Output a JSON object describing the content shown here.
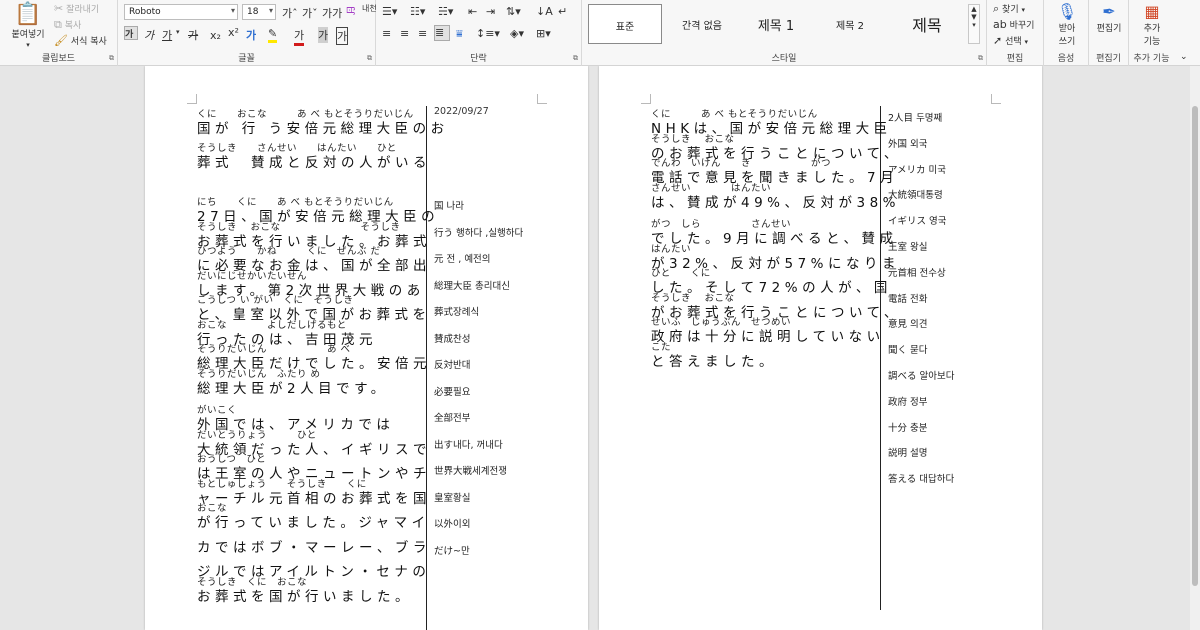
{
  "ribbon": {
    "clipboard": {
      "label": "클립보드",
      "paste": "붙여넣기",
      "cut": "잘라내기",
      "copy": "복사",
      "format_painter": "서식 복사"
    },
    "font": {
      "label": "글꼴",
      "font_name": "Roboto",
      "font_size": "18"
    },
    "paragraph": {
      "label": "단락"
    },
    "styles": {
      "label": "스타일",
      "items": [
        "표준",
        "간격 없음",
        "제목 1",
        "제목 2",
        "제목"
      ]
    },
    "editing": {
      "label": "편집",
      "find": "찾기",
      "replace": "바꾸기",
      "select": "선택"
    },
    "voice": {
      "label": "음성",
      "dictate_line1": "받아",
      "dictate_line2": "쓰기"
    },
    "editor": {
      "label": "편집기",
      "button": "편집기"
    },
    "addins": {
      "label": "추가 기능",
      "button_line1": "추가",
      "button_line2": "기능"
    }
  },
  "page1": {
    "date": "2022/09/27",
    "title_lines": [
      {
        "gloss": "くに　　おこな　　　あ べ もとそうりだいじん",
        "text": "国が 行 う安倍元総理大臣のお"
      },
      {
        "gloss": "そうしき　　さんせい　　はんたい　　ひと",
        "text": "葬式　賛成と反対の人がいる"
      }
    ],
    "body_lines": [
      {
        "gloss": "にち　　くに　　あ べ もとそうりだいじん",
        "text": "27日、国が安倍元総理大臣の"
      },
      {
        "gloss": "そうしき　 おこな　　　　　　　　そうしき",
        "text": "お葬式を行いました。お葬式"
      },
      {
        "gloss": "ひつよう　　かね　　　くに　ぜんぶ だ",
        "text": "に必要なお金は、国が全部出"
      },
      {
        "gloss": "だいにじせかいたいせん",
        "text": "します。第2次世界大戦のあ"
      },
      {
        "gloss": "こうしつ い がい　くに　そうしき",
        "text": "と、皇室以外で国がお葬式を"
      },
      {
        "gloss": "おこな　　　　よしだしげるもと",
        "text": "行ったのは、吉田茂元"
      },
      {
        "gloss": "そうりだいじん　　　　　　あ べ",
        "text": "総理大臣だけでした。安倍元"
      },
      {
        "gloss": "そうりだいじん　ふたり め",
        "text": "総理大臣が2人目です。"
      },
      {
        "gloss": "がいこく",
        "text": "外国では、アメリカでは"
      },
      {
        "gloss": "だいとうりょう　　　ひと",
        "text": "大統領だった人、イギリスで"
      },
      {
        "gloss": "おうしつ　ひと",
        "text": "は王室の人やニュートンやチ"
      },
      {
        "gloss": "もとしゅしょう　　そうしき　　くに",
        "text": "ャーチル元首相のお葬式を国"
      },
      {
        "gloss": "おこな",
        "text": "が行っていました。ジャマイ"
      },
      {
        "gloss": "",
        "text": "カではボブ・マーレー、ブラ"
      },
      {
        "gloss": "",
        "text": "ジルではアイルトン・セナの"
      },
      {
        "gloss": "そうしき　くに　おこな",
        "text": "お葬式を国が行いました。"
      }
    ],
    "vocab": [
      "国 나라",
      "行う 행하다 ,실행하다",
      "元 전 , 예전의",
      "総理大臣 총리대신",
      "葬式장례식",
      "賛成찬성",
      "反対반대",
      "必要필요",
      "全部전부",
      "出す내다, 꺼내다",
      "世界大戦세계전쟁",
      "皇室황실",
      "以外이외",
      "だけ~만"
    ]
  },
  "page2": {
    "body_lines": [
      {
        "gloss": "くに　　　あ べ もとそうりだいじん",
        "text": "NHKは、国が安倍元総理大臣"
      },
      {
        "gloss": "そうしき　 おこな",
        "text": "のお葬式を行うことについて、"
      },
      {
        "gloss": "でんわ　いけん　　き　　　　　　がつ",
        "text": "電話で意見を聞きました。7月"
      },
      {
        "gloss": "さんせい　　　　はんたい",
        "text": "は、賛成が49%、反対が38%"
      },
      {
        "gloss": "がつ　しら　　　　　さんせい",
        "text": "でした。9月に調べると、賛成"
      },
      {
        "gloss": "はんたい",
        "text": "が32%、反対が57%になりま"
      },
      {
        "gloss": "ひと　　くに",
        "text": "した。そして72%の人が、国"
      },
      {
        "gloss": "そうしき　 おこな",
        "text": "がお葬式を行うことについて、"
      },
      {
        "gloss": "せいふ　じゅうぶん　せつめい",
        "text": "政府は十分に説明していない"
      },
      {
        "gloss": "こた",
        "text": "と答えました。"
      }
    ],
    "vocab": [
      "2人目 두명째",
      "外国 외국",
      "アメリカ 미국",
      "大統領대통령",
      "イギリス 영국",
      "王室 왕실",
      "元首相 전수상",
      "電話 전화",
      "意見 의견",
      "聞く 묻다",
      "調べる 알아보다",
      "政府 정부",
      "十分 충분",
      "説明 설명",
      "答える 대답하다"
    ]
  }
}
